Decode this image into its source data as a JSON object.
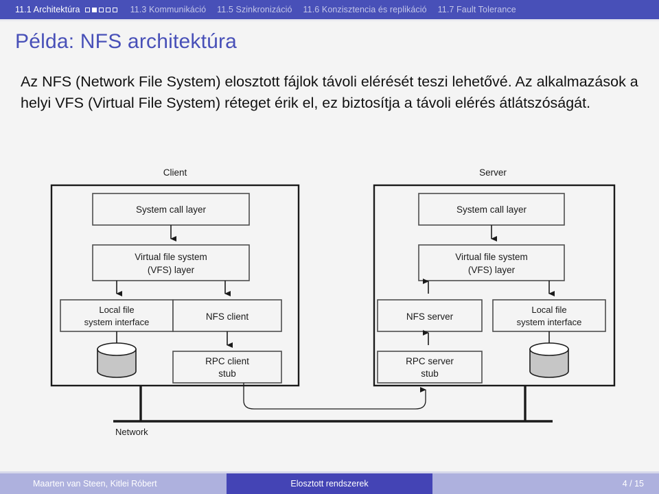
{
  "nav": {
    "sections": [
      {
        "label": "11.1 Architektúra",
        "current": true,
        "dots": [
          false,
          true,
          false,
          false,
          false
        ]
      },
      {
        "label": "11.3 Kommunikáció",
        "current": false,
        "dots": []
      },
      {
        "label": "11.5 Szinkronizáció",
        "current": false,
        "dots": []
      },
      {
        "label": "11.6 Konzisztencia és replikáció",
        "current": false,
        "dots": []
      },
      {
        "label": "11.7 Fault Tolerance",
        "current": false,
        "dots": []
      }
    ],
    "bar_color": "#4850b8",
    "active_text_color": "#ffffff",
    "inactive_text_color": "#c3c6e8"
  },
  "slide": {
    "title": "Példa: NFS architektúra",
    "title_color": "#4850b8",
    "body": "Az NFS (Network File System) elosztott fájlok távoli elérését teszi lehetővé. Az alkalmazások a helyi VFS (Virtual File System) réteget érik el, ez biztosítja a távoli elérés átlátszóságát."
  },
  "diagram": {
    "client_label": "Client",
    "server_label": "Server",
    "network_label": "Network",
    "client_boxes": {
      "system_call": "System call layer",
      "vfs_line1": "Virtual file system",
      "vfs_line2": "(VFS) layer",
      "local_fs_line1": "Local file",
      "local_fs_line2": "system interface",
      "nfs": "NFS client",
      "rpc_line1": "RPC client",
      "rpc_line2": "stub"
    },
    "server_boxes": {
      "system_call": "System call layer",
      "vfs_line1": "Virtual file system",
      "vfs_line2": "(VFS) layer",
      "local_fs_line1": "Local file",
      "local_fs_line2": "system interface",
      "nfs": "NFS server",
      "rpc_line1": "RPC server",
      "rpc_line2": "stub"
    },
    "disk_fill": "#c6c6c6",
    "box_fill": "#f4f4f4",
    "line_color": "#1a1a1a"
  },
  "footer": {
    "author": "Maarten van Steen, Kitlei Róbert",
    "course": "Elosztott rendszerek",
    "page": "4 / 15",
    "light_color": "#aeb1de",
    "dark_color": "#4444b5"
  }
}
